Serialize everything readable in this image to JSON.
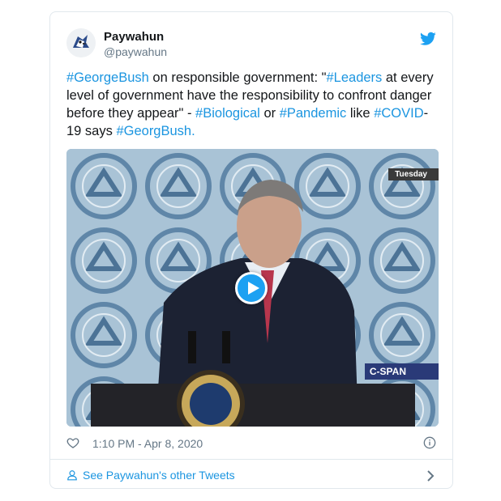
{
  "tweet": {
    "author_name": "Paywahun",
    "author_handle": "@paywahun",
    "text_parts": [
      {
        "t": "#GeorgeBush",
        "tag": true
      },
      {
        "t": " on responsible government: \"",
        "tag": false
      },
      {
        "t": "#Leaders",
        "tag": true
      },
      {
        "t": " at every level of government have the responsibility to confront danger before they appear\" - ",
        "tag": false
      },
      {
        "t": "#Biological",
        "tag": true
      },
      {
        "t": " or ",
        "tag": false
      },
      {
        "t": "#Pandemic",
        "tag": true
      },
      {
        "t": " like ",
        "tag": false
      },
      {
        "t": "#COVID",
        "tag": true
      },
      {
        "t": "-19 says ",
        "tag": false
      },
      {
        "t": "#GeorgBush",
        "tag": true
      },
      {
        "t": ".",
        "tag": false
      }
    ],
    "timestamp": "1:10 PM - Apr 8, 2020"
  },
  "media": {
    "overlay_day": "Tuesday",
    "overlay_network": "C-SPAN",
    "play_icon": "play-icon"
  },
  "footer": {
    "label": "See Paywahun's other Tweets"
  },
  "colors": {
    "link": "#1b95e0",
    "twitter_blue": "#1da1f2",
    "muted": "#657786",
    "border": "#e1e8ed"
  }
}
